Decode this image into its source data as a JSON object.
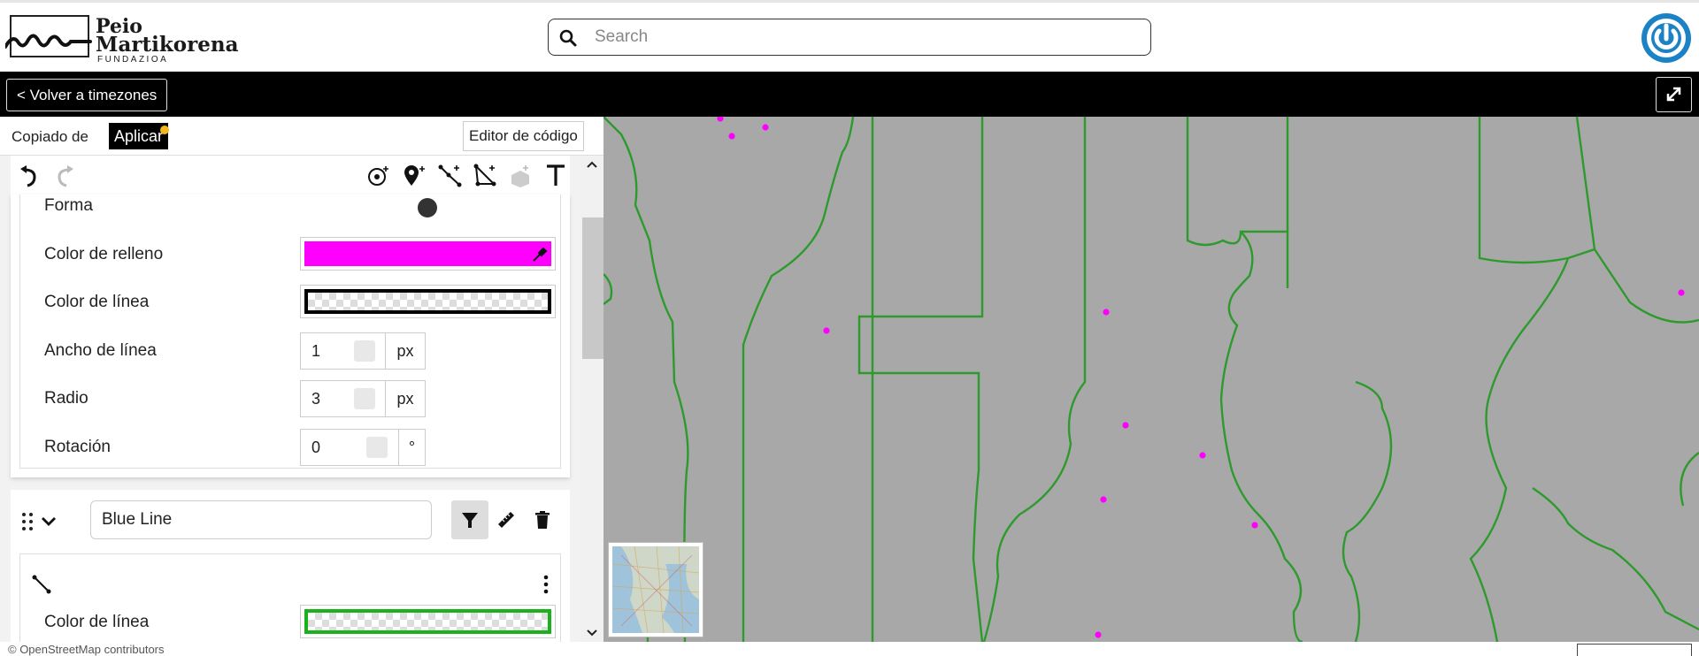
{
  "header": {
    "logo_line1": "Peio",
    "logo_line2": "Martikorena",
    "logo_sub": "FUNDAZIOA",
    "search_placeholder": "Search",
    "search_value": "",
    "power_icon": "power-icon"
  },
  "nav": {
    "back_label": "< Volver a timezones",
    "fullscreen_icon": "expand-icon"
  },
  "editor": {
    "copied_label": "Copiado de",
    "apply_label": "Aplicar",
    "apply_badge_color": "#f5b51e",
    "code_editor_label": "Editor de código",
    "toolbar_icons": [
      "undo-icon",
      "redo-icon",
      "add-point-icon",
      "add-marker-icon",
      "add-line-icon",
      "add-polygon-icon",
      "add-3d-icon",
      "add-text-icon"
    ]
  },
  "style_panel": {
    "shape_label": "Forma",
    "fill_color_label": "Color de relleno",
    "fill_color": "#ff00ff",
    "line_color_label": "Color de línea",
    "line_color": "#000000",
    "line_width_label": "Ancho de línea",
    "line_width_value": "1",
    "line_width_unit": "px",
    "radius_label": "Radio",
    "radius_value": "3",
    "radius_unit": "px",
    "rotation_label": "Rotación",
    "rotation_value": "0",
    "rotation_unit": "°"
  },
  "layer2": {
    "name": "Blue Line",
    "line_color_label": "Color de línea",
    "line_color": "#1cb01c"
  },
  "map": {
    "background": "#a8a8a8",
    "border_color": "#2e9a2e",
    "point_color": "#ff00ff"
  },
  "footer": {
    "attribution": "© OpenStreetMap contributors"
  }
}
